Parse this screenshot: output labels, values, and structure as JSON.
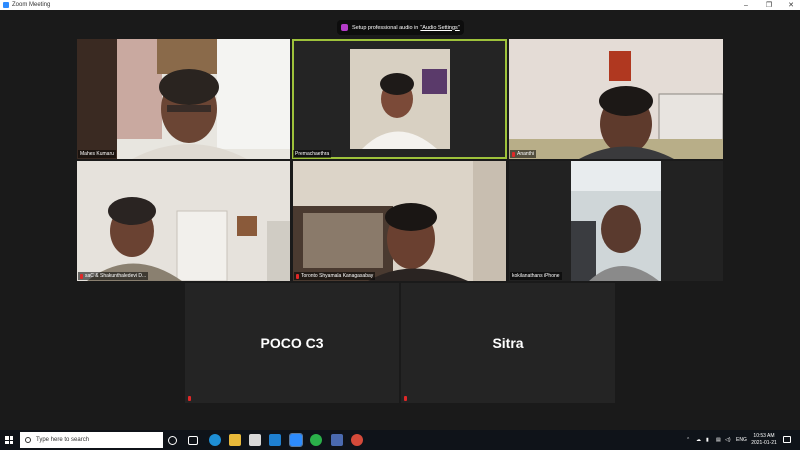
{
  "window": {
    "title": "Zoom Meeting"
  },
  "notice": {
    "text": "Setup professional audio in",
    "link": "\"Audio Settings\""
  },
  "tiles": [
    {
      "name": "Mahes Kumaru"
    },
    {
      "name": "Premachaethra"
    },
    {
      "name": "Ananthi"
    },
    {
      "name": "saC & Shakunthaledevi D..."
    },
    {
      "name": "Toronto Shyamala Kanagasabay"
    },
    {
      "name": "kokilanathans iPhone"
    },
    {
      "name": "POCO C3"
    },
    {
      "name": "Sitra"
    }
  ],
  "taskbar": {
    "search_placeholder": "Type here to search",
    "lang": "ENG",
    "time": "10:53 AM",
    "date": "2021-01-21"
  },
  "colors": {
    "active_speaker_border": "#9ec23b",
    "muted_mic": "#e02828",
    "zoom_blue": "#2d8cff"
  }
}
